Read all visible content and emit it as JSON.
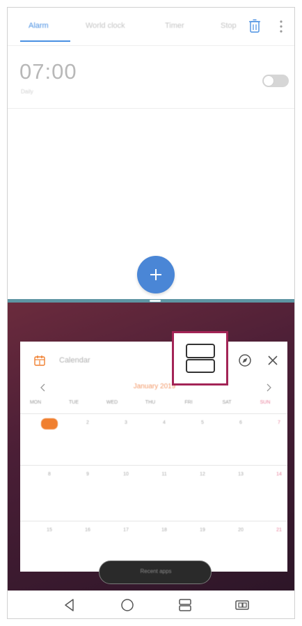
{
  "top_app": {
    "tabs": [
      {
        "label": "Alarm",
        "active": true
      },
      {
        "label": "World clock",
        "active": false
      },
      {
        "label": "Timer",
        "active": false
      },
      {
        "label": "Stop",
        "active": false
      }
    ],
    "alarm": {
      "time": "07:00",
      "subtitle": "Daily",
      "enabled": false
    },
    "icons": {
      "delete": "trash-icon",
      "more": "more-vertical-icon",
      "add": "plus-icon"
    },
    "accent_color": "#4a90e2"
  },
  "calendar_window": {
    "title": "Calendar",
    "month_label": "January 2019",
    "weekdays": [
      "MON",
      "TUE",
      "WED",
      "THU",
      "FRI",
      "SAT",
      "SUN"
    ],
    "weeks": [
      [
        "1",
        "2",
        "3",
        "4",
        "5",
        "6",
        "7"
      ],
      [
        "8",
        "9",
        "10",
        "11",
        "12",
        "13",
        "14"
      ],
      [
        "15",
        "16",
        "17",
        "18",
        "19",
        "20",
        "21"
      ]
    ],
    "today_index": [
      0,
      0
    ],
    "accent_color": "#f07f2f",
    "highlight_color": "#a32456"
  },
  "dock": {
    "label": "Recent apps"
  }
}
